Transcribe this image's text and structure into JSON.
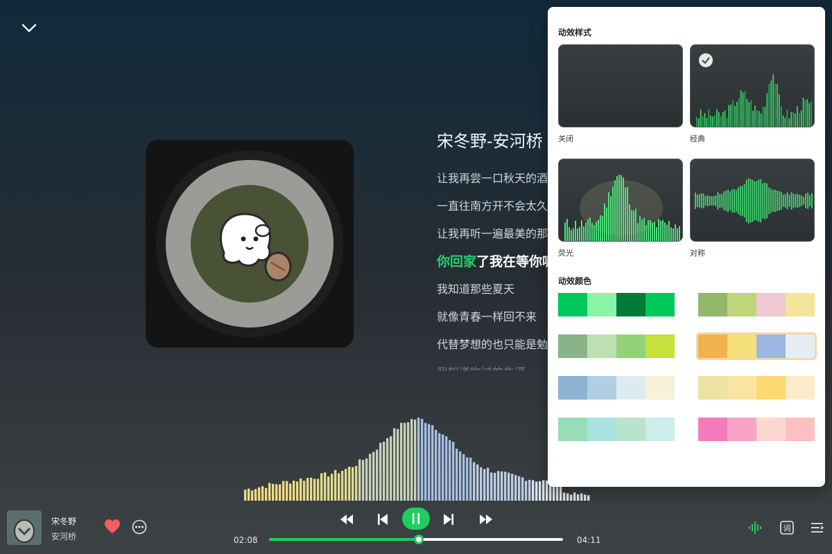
{
  "song": {
    "title_line": "宋冬野-安河桥",
    "name": "宋冬野",
    "artist_line": "安河桥"
  },
  "lyrics": {
    "lines": [
      "让我再尝一口秋天的酒",
      "一直往南方开不会太久",
      "让我再听一遍最美的那一首",
      "",
      "我知道那些夏天",
      "就像青春一样回不来",
      "代替梦想的也只能是勉为其难",
      "我知道吹过的牛逼"
    ],
    "active_highlight": "你回家",
    "active_rest": "了我在等你呢"
  },
  "player": {
    "elapsed": "02:08",
    "total": "04:11",
    "progress_fraction": 0.51,
    "liked": true,
    "accent_color": "#1fce61"
  },
  "effects_panel": {
    "style_heading": "动效样式",
    "styles": [
      {
        "label": "关闭",
        "selected": false
      },
      {
        "label": "经典",
        "selected": true
      },
      {
        "label": "荧光",
        "selected": false
      },
      {
        "label": "对称",
        "selected": false
      }
    ],
    "color_heading": "动效颜色",
    "palettes": [
      [
        "#00c85a",
        "#8af5a6",
        "#007c36",
        "#00c85a"
      ],
      [
        "#92b86c",
        "#c0d47a",
        "#f0c8d2",
        "#f6e49a"
      ],
      [
        "#88b488",
        "#bce0b2",
        "#94d27a",
        "#c6e03c"
      ],
      [
        "#f2b24e",
        "#f5e17a",
        "#9cb6e4",
        "#e4eef2"
      ],
      [
        "#8eb2d2",
        "#b0cfe2",
        "#ddebf1",
        "#f5f2d6"
      ],
      [
        "#ece3a2",
        "#fbe4a2",
        "#fdd972",
        "#fbebc8"
      ],
      [
        "#98dcb8",
        "#a8e2de",
        "#b8e4cc",
        "#cdecec"
      ],
      [
        "#f47cbc",
        "#f9a4c6",
        "#fcd8d0",
        "#fcc0c0"
      ]
    ],
    "selected_palette": 3
  },
  "icons": {
    "collapse": "chevron-down-icon",
    "like": "heart-icon",
    "more": "more-icon",
    "rewind": "rewind-icon",
    "previous": "skip-previous-icon",
    "pause": "pause-icon",
    "next": "skip-next-icon",
    "forward": "fast-forward-icon",
    "effects": "sound-wave-icon",
    "lyrics": "lyrics-icon",
    "playlist": "playlist-icon"
  }
}
